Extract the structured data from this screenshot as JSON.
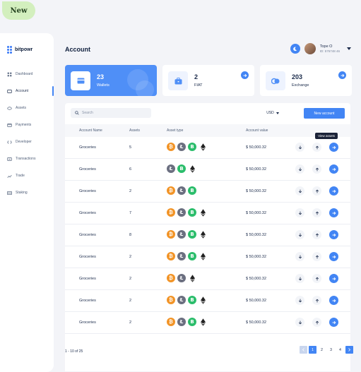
{
  "badge": "New",
  "brand": {
    "name": "bitpowr"
  },
  "sidebar": {
    "items": [
      {
        "label": "Dashboard",
        "icon": "grid-icon"
      },
      {
        "label": "Account",
        "icon": "wallet-icon",
        "active": true
      },
      {
        "label": "Assets",
        "icon": "coin-icon"
      },
      {
        "label": "Payments",
        "icon": "card-icon"
      },
      {
        "label": "Developer",
        "icon": "code-icon"
      },
      {
        "label": "Transactions",
        "icon": "list-icon"
      },
      {
        "label": "Trade",
        "icon": "chart-icon"
      },
      {
        "label": "Staking",
        "icon": "stack-icon"
      }
    ]
  },
  "header": {
    "title": "Account",
    "user_name": "Tope O",
    "user_id": "ID: 576748 46"
  },
  "stats": [
    {
      "value": "23",
      "label": "Wallets",
      "icon": "wallet-icon"
    },
    {
      "value": "2",
      "label": "FIAT",
      "icon": "briefcase-icon"
    },
    {
      "value": "203",
      "label": "Exchange",
      "icon": "exchange-icon"
    }
  ],
  "toolbar": {
    "search_placeholder": "Search",
    "currency": "USD",
    "new_account_label": "New account"
  },
  "table": {
    "columns": [
      "Account Name",
      "Assets",
      "Asset type",
      "Account value"
    ],
    "tooltip": "View assets",
    "rows": [
      {
        "name": "Groceries",
        "assets": "5",
        "coins": [
          "btc",
          "ltc",
          "grn",
          "eth"
        ],
        "value": "$ 50,000.32"
      },
      {
        "name": "Groceries",
        "assets": "6",
        "coins": [
          "ltc",
          "grn",
          "eth"
        ],
        "value": "$ 50,000.32"
      },
      {
        "name": "Groceries",
        "assets": "2",
        "coins": [
          "btc",
          "ltc",
          "grn"
        ],
        "value": "$ 50,000.32"
      },
      {
        "name": "Groceries",
        "assets": "7",
        "coins": [
          "btc",
          "ltc",
          "grn",
          "eth"
        ],
        "value": "$ 50,000.32"
      },
      {
        "name": "Groceries",
        "assets": "8",
        "coins": [
          "btc",
          "ltc",
          "grn",
          "eth"
        ],
        "value": "$ 50,000.32"
      },
      {
        "name": "Groceries",
        "assets": "2",
        "coins": [
          "btc",
          "ltc",
          "grn",
          "eth"
        ],
        "value": "$ 50,000.32"
      },
      {
        "name": "Groceries",
        "assets": "2",
        "coins": [
          "btc",
          "ltc",
          "eth"
        ],
        "value": "$ 50,000.32"
      },
      {
        "name": "Groceries",
        "assets": "2",
        "coins": [
          "btc",
          "ltc",
          "grn",
          "eth"
        ],
        "value": "$ 50,000.32"
      },
      {
        "name": "Groceries",
        "assets": "2",
        "coins": [
          "btc",
          "ltc",
          "grn",
          "eth"
        ],
        "value": "$ 50,000.32"
      }
    ]
  },
  "pagination": {
    "summary": "1 - 10 of 25",
    "pages": [
      "1",
      "2",
      "3",
      "4"
    ],
    "current": "1"
  },
  "colors": {
    "accent": "#4285f4",
    "card_primary": "#4f8ff7",
    "bitcoin": "#f29427",
    "litecoin": "#6b6f80",
    "green_coin": "#2bbd6b"
  }
}
